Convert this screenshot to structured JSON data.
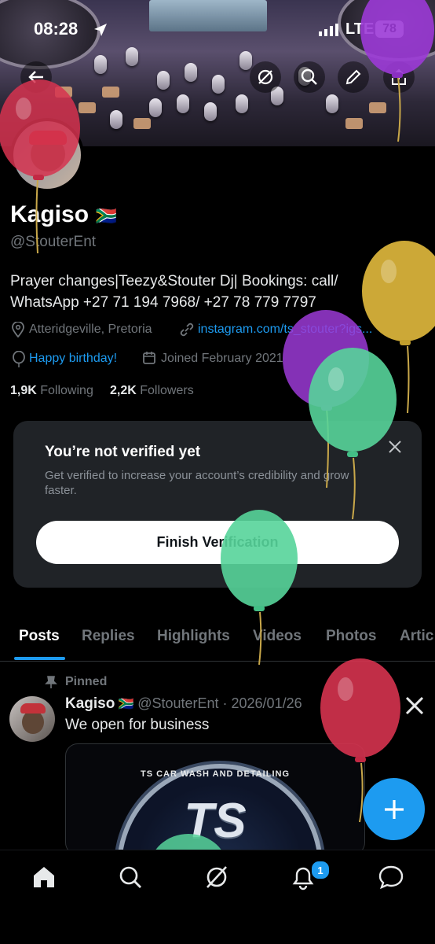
{
  "status_bar": {
    "time": "08:28",
    "network": "LTE",
    "battery": "78"
  },
  "profile": {
    "name": "Kagiso",
    "flag": "🇿🇦",
    "handle": "@StouterEnt",
    "bio_line1": "Prayer changes|Teezy&Stouter Dj| Bookings: call/",
    "bio_line2": "WhatsApp +27 71 194 7968/ +27 78 779 7797",
    "location": "Atteridgeville, Pretoria",
    "website": "instagram.com/ts_stouter?igs...",
    "birthday": "Happy birthday!",
    "joined": "Joined February 2021",
    "following_count": "1,9K",
    "following_label": "Following",
    "followers_count": "2,2K",
    "followers_label": "Followers"
  },
  "verify_card": {
    "title": "You’re not verified yet",
    "body": "Get verified to increase your account’s credibility and grow faster.",
    "button": "Finish Verification"
  },
  "tabs": [
    "Posts",
    "Replies",
    "Highlights",
    "Videos",
    "Photos",
    "Artic"
  ],
  "active_tab": "Posts",
  "post": {
    "pinned_label": "Pinned",
    "author": "Kagiso",
    "flag": "🇿🇦",
    "handle_date": "@StouterEnt · 2026/01/26",
    "text": "We open for business",
    "media_text": "TS CAR WASH AND DETAILING",
    "media_logo": "TS"
  },
  "bottom_nav": {
    "notification_count": "1"
  },
  "icons": [
    "back-arrow-icon",
    "grok-icon",
    "search-icon",
    "edit-pencil-icon",
    "share-icon",
    "location-pin-icon",
    "link-icon",
    "balloon-icon",
    "calendar-icon",
    "close-icon",
    "pin-icon",
    "x-logo-icon",
    "plus-icon",
    "home-icon",
    "explore-icon",
    "grok-nav-icon",
    "bell-icon",
    "messages-icon"
  ],
  "colors": {
    "accent": "#1d9bf0",
    "background": "#000000",
    "card": "#202327",
    "muted": "#71767b"
  }
}
